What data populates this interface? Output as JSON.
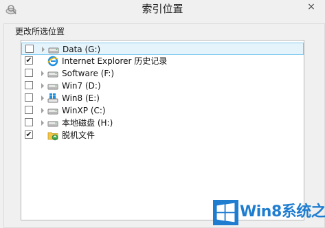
{
  "window": {
    "title": "索引位置",
    "close_label": "×"
  },
  "group": {
    "label": "更改所选位置"
  },
  "tree": {
    "items": [
      {
        "label": "Data (G:)",
        "checked": false,
        "expandable": true,
        "icon": "drive-icon",
        "selected": true
      },
      {
        "label": "Internet Explorer 历史记录",
        "checked": true,
        "expandable": false,
        "icon": "internet-explorer-icon",
        "selected": false
      },
      {
        "label": "Software (F:)",
        "checked": false,
        "expandable": true,
        "icon": "drive-icon",
        "selected": false
      },
      {
        "label": "Win7 (D:)",
        "checked": false,
        "expandable": true,
        "icon": "drive-icon",
        "selected": false
      },
      {
        "label": "Win8 (E:)",
        "checked": false,
        "expandable": true,
        "icon": "windows-drive-icon",
        "selected": false
      },
      {
        "label": "WinXP (C:)",
        "checked": false,
        "expandable": true,
        "icon": "drive-icon",
        "selected": false
      },
      {
        "label": "本地磁盘 (H:)",
        "checked": false,
        "expandable": true,
        "icon": "drive-icon",
        "selected": false
      },
      {
        "label": "脱机文件",
        "checked": true,
        "expandable": false,
        "icon": "offline-files-icon",
        "selected": false
      }
    ]
  },
  "watermark": {
    "text": "Win8系统之家"
  },
  "colors": {
    "selection_bg": "#e5f3fb",
    "selection_border": "#7fc9f0",
    "watermark": "#1f7dd0"
  }
}
